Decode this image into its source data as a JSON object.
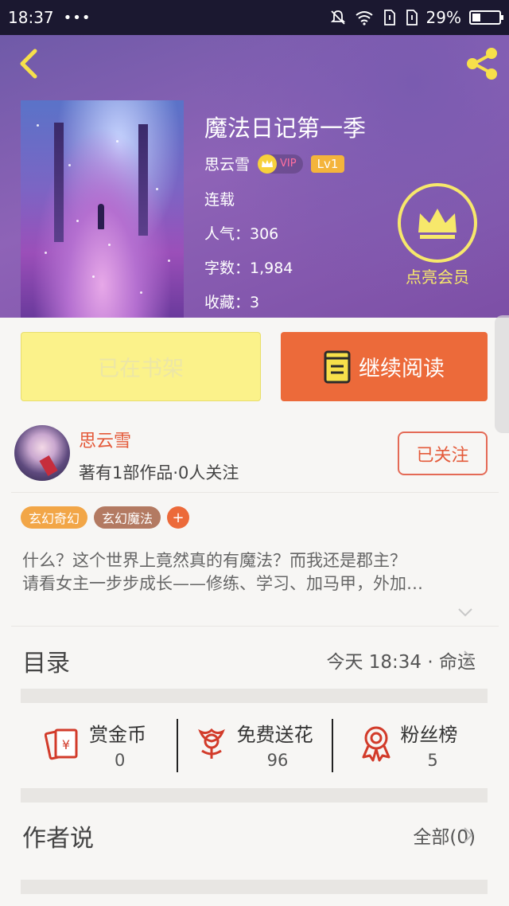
{
  "status_bar": {
    "time": "18:37",
    "more": "•••",
    "battery_percent": "29%"
  },
  "book": {
    "title": "魔法日记第一季",
    "author": "思云雪",
    "vip_label": "VIP",
    "level": "Lv1",
    "status": "连载",
    "popularity": "人气：306",
    "word_count": "字数：1,984",
    "favorites": "收藏：3"
  },
  "vip_member": {
    "label": "点亮会员"
  },
  "actions": {
    "shelf_label": "已在书架",
    "read_label": "继续阅读"
  },
  "author_card": {
    "name": "思云雪",
    "info": "著有1部作品·0人关注",
    "follow_label": "已关注"
  },
  "tags": [
    "玄幻奇幻",
    "玄幻魔法"
  ],
  "tag_add": "+",
  "description": {
    "line1": "什么？这个世界上竟然真的有魔法？而我还是郡主？",
    "line2": "请看女主一步步成长——修练、学习、加马甲，外加…"
  },
  "toc": {
    "title": "目录",
    "update": "今天 18:34 · 命运"
  },
  "stats": [
    {
      "label": "赏金币",
      "value": "0",
      "icon": "red-envelope-icon"
    },
    {
      "label": "免费送花",
      "value": "96",
      "icon": "flower-icon"
    },
    {
      "label": "粉丝榜",
      "value": "5",
      "icon": "award-ribbon-icon"
    }
  ],
  "author_says": {
    "title": "作者说",
    "all_label": "全部(0)"
  },
  "colors": {
    "accent": "#ec6a3a",
    "shelf": "#fbf28a",
    "vip_gold": "#f7e86b",
    "author_red": "#e45a3a"
  }
}
